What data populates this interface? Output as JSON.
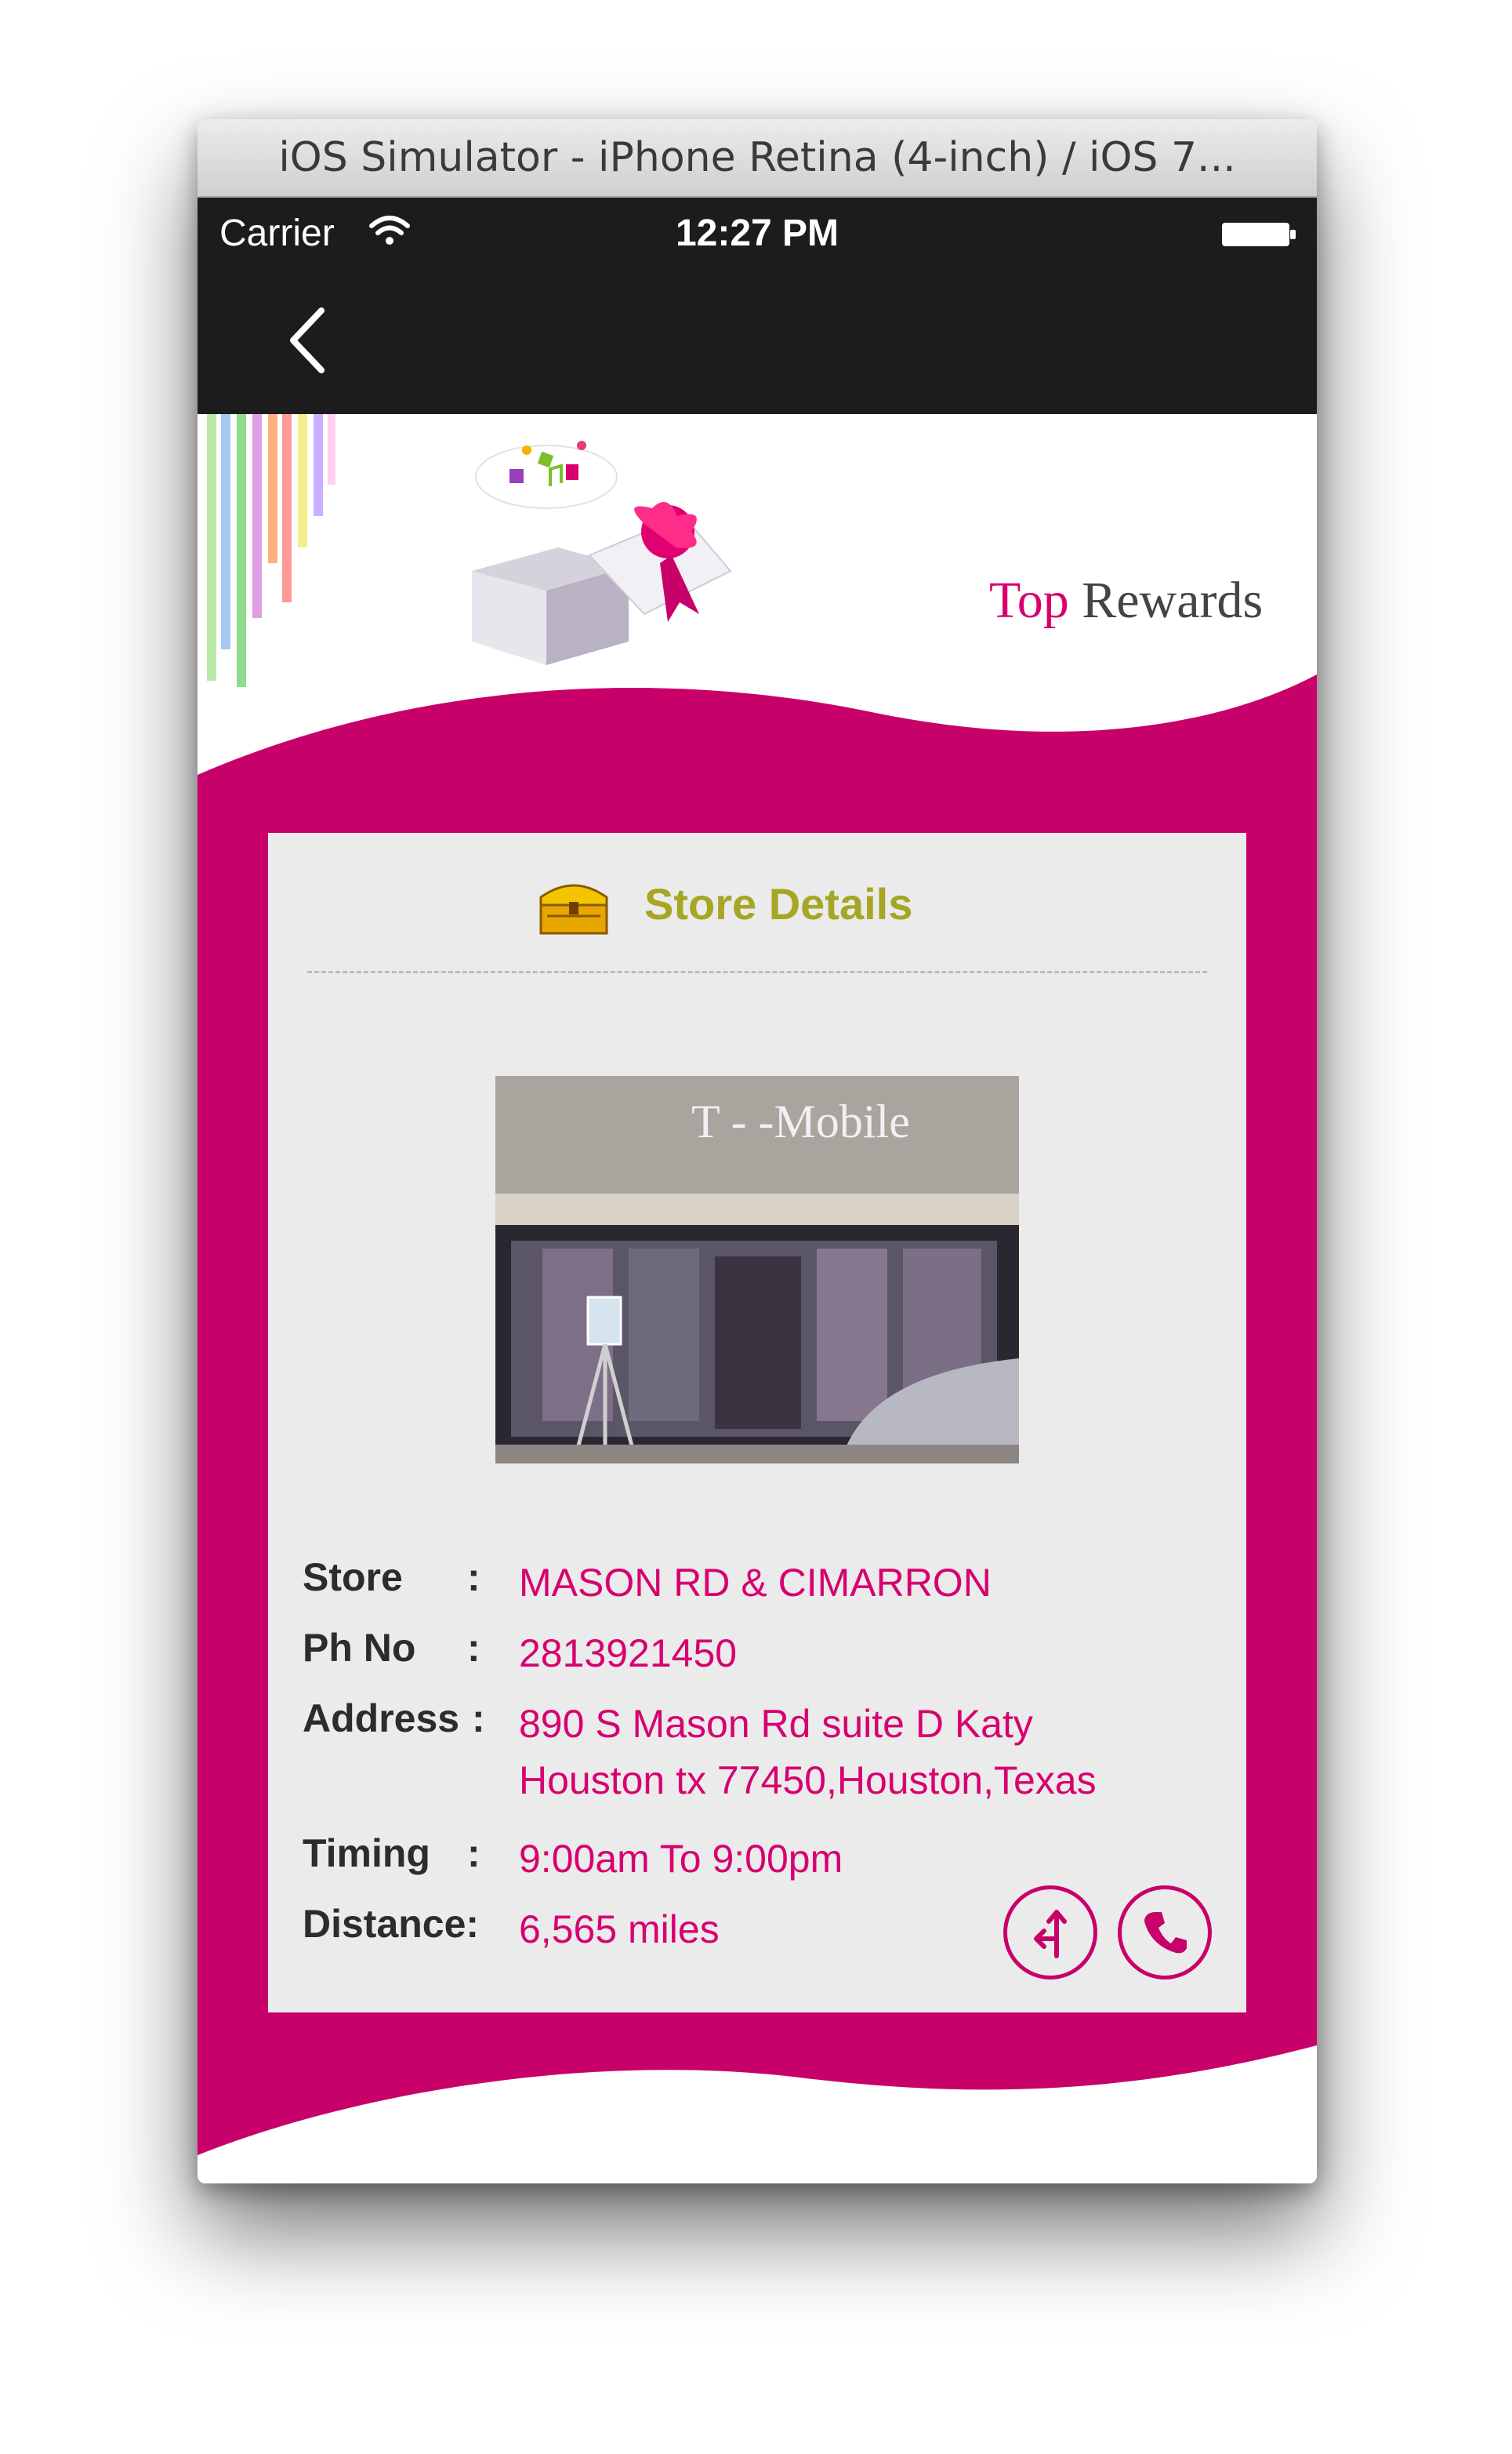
{
  "window": {
    "title": "iOS Simulator - iPhone Retina (4-inch) / iOS 7..."
  },
  "status_bar": {
    "carrier": "Carrier",
    "time": "12:27 PM"
  },
  "nav": {
    "back_icon": "chevron-left-icon"
  },
  "logo": {
    "word1": "Top",
    "word2": " Rewards",
    "icon": "gift-box-icon"
  },
  "card": {
    "title": "Store Details",
    "icon": "treasure-chest-icon",
    "details": [
      {
        "label": "Store",
        "colon": ":",
        "value": "MASON RD & CIMARRON"
      },
      {
        "label": "Ph No",
        "colon": ":",
        "value": "2813921450"
      },
      {
        "label": "Address",
        "colon": ":",
        "value_line1": "890 S Mason Rd suite D Katy",
        "value_line2": "Houston tx 77450,Houston,Texas"
      },
      {
        "label": "Timing",
        "colon": ":",
        "value": "9:00am To 9:00pm"
      },
      {
        "label": "Distance:",
        "colon": "",
        "value": "6,565 miles"
      }
    ],
    "actions": {
      "directions_icon": "directions-icon",
      "call_icon": "phone-icon"
    }
  },
  "photo": {
    "sign": "T - -Mobile"
  },
  "colors": {
    "brand_magenta": "#c8006a",
    "title_olive": "#a6a624",
    "nav_black": "#1c1c1c"
  }
}
